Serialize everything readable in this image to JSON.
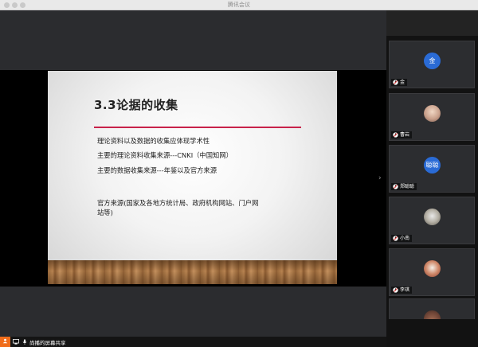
{
  "window": {
    "title": "腾讯会议"
  },
  "slide": {
    "title": "3.3论据的收集",
    "bullets": [
      "理论资料以及数据的收集应体现学术性",
      "主要的理论资料收集来源---CNKI（中国知网）",
      "主要的数据收集来源---年鉴以及官方来源",
      "官方来源(国家及各地方统计局、政府机构网站、门户网站等)"
    ],
    "accent_color": "#c8224a"
  },
  "participants": [
    {
      "name": "金",
      "avatar_text": "金",
      "avatar_color": "#2a6bd6",
      "mic": "muted"
    },
    {
      "name": "曹岩",
      "avatar_text": "",
      "avatar_type": "photo",
      "mic": "muted"
    },
    {
      "name": "郑聪聪",
      "avatar_text": "聪聪",
      "avatar_color": "#2a6bd6",
      "mic": "muted"
    },
    {
      "name": "小南",
      "avatar_text": "",
      "avatar_type": "photo",
      "mic": "muted"
    },
    {
      "name": "李琪",
      "avatar_text": "",
      "avatar_type": "photo",
      "mic": "muted"
    }
  ],
  "bottom_bar": {
    "share_label": "尚播的屏幕共享",
    "icons": [
      "screen-share-icon",
      "monitor-icon",
      "microphone-icon"
    ]
  },
  "colors": {
    "share_button": "#f06d1b",
    "panel_bg": "#121212",
    "stage_bg": "#2b2c2f"
  }
}
